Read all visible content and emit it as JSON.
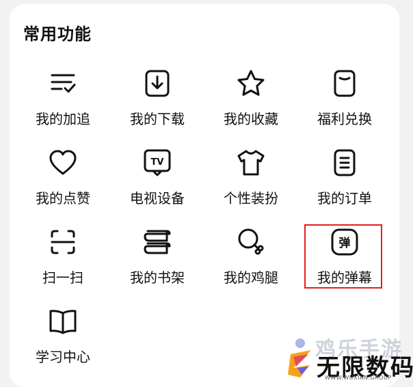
{
  "section": {
    "title": "常用功能"
  },
  "items": [
    {
      "label": "我的加追",
      "icon": "list-check-icon"
    },
    {
      "label": "我的下载",
      "icon": "download-icon"
    },
    {
      "label": "我的收藏",
      "icon": "star-icon"
    },
    {
      "label": "福利兑换",
      "icon": "voucher-icon"
    },
    {
      "label": "我的点赞",
      "icon": "heart-icon"
    },
    {
      "label": "电视设备",
      "icon": "tv-icon"
    },
    {
      "label": "个性装扮",
      "icon": "tshirt-icon"
    },
    {
      "label": "我的订单",
      "icon": "order-icon"
    },
    {
      "label": "扫一扫",
      "icon": "scan-icon"
    },
    {
      "label": "我的书架",
      "icon": "bookshelf-icon"
    },
    {
      "label": "我的鸡腿",
      "icon": "drumstick-icon"
    },
    {
      "label": "我的弹幕",
      "icon": "danmu-icon",
      "icon_text": "弹"
    },
    {
      "label": "学习中心",
      "icon": "book-icon"
    }
  ],
  "tv_icon_text": "TV",
  "highlighted_item": "我的弹幕",
  "colors": {
    "highlight": "#e0201d",
    "text": "#111111",
    "card": "#ffffff"
  },
  "watermark": {
    "top": "鸡乐手游",
    "main": "无限数码",
    "url": "WWW.WUXIAN.GROUP"
  }
}
